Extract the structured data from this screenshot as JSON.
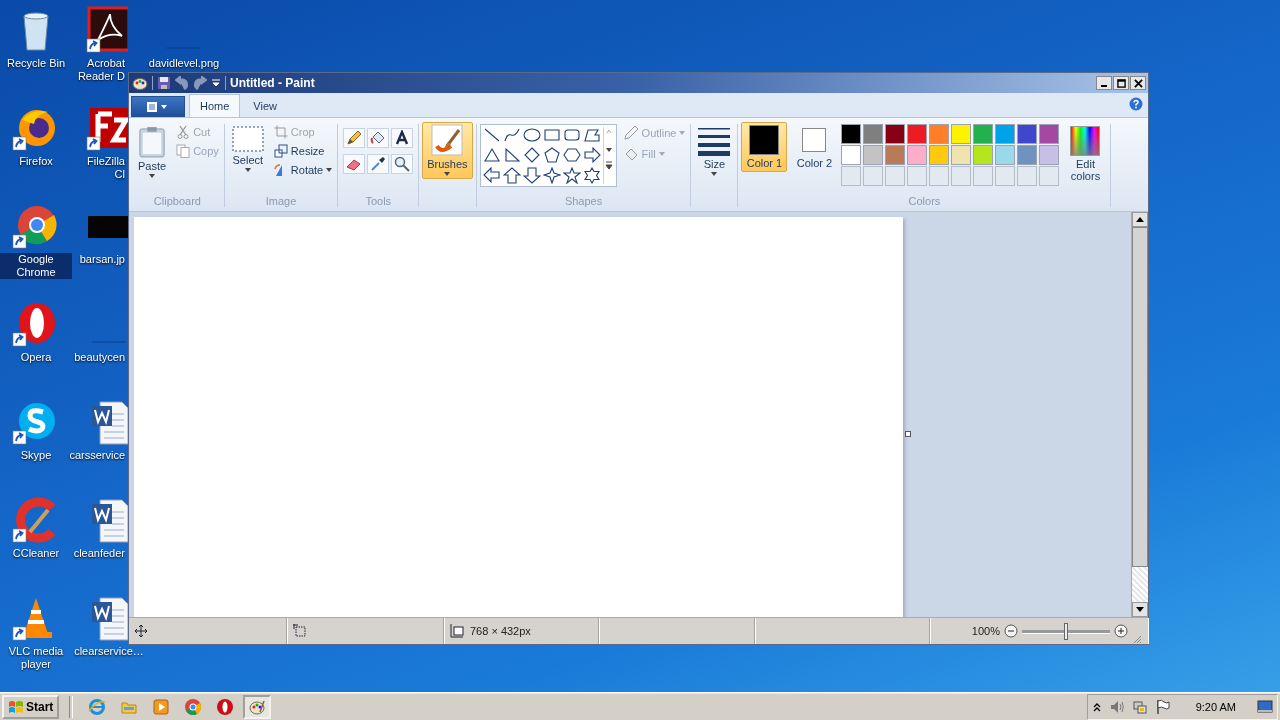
{
  "desktop_icons": [
    {
      "label": "Recycle Bin",
      "kind": "recycle",
      "selected": false
    },
    {
      "label": "Firefox",
      "kind": "firefox",
      "selected": false
    },
    {
      "label": "Google Chrome",
      "kind": "chrome",
      "selected": true
    },
    {
      "label": "Opera",
      "kind": "opera",
      "selected": false
    },
    {
      "label": "Skype",
      "kind": "skype",
      "selected": false
    },
    {
      "label": "CCleaner",
      "kind": "ccleaner",
      "selected": false
    },
    {
      "label": "VLC media player",
      "kind": "vlc",
      "selected": false
    },
    {
      "label": "Acrobat Reader D",
      "kind": "acrobat",
      "selected": false
    },
    {
      "label": "FileZilla Cl",
      "kind": "filezilla",
      "selected": false
    },
    {
      "label": "barsan.jp",
      "kind": "dark-image",
      "selected": false
    },
    {
      "label": "beautycen",
      "kind": "blank-image",
      "selected": false
    },
    {
      "label": "carsservice",
      "kind": "word",
      "selected": false
    },
    {
      "label": "cleanfeder",
      "kind": "word",
      "selected": false
    },
    {
      "label": "clearservice…",
      "kind": "word",
      "selected": false
    },
    {
      "label": "davidlevel.png",
      "kind": "blank-image",
      "selected": false
    }
  ],
  "window": {
    "title": "Untitled - Paint"
  },
  "tabs": [
    {
      "label": "Home",
      "selected": true
    },
    {
      "label": "View",
      "selected": false
    }
  ],
  "clipboard": {
    "paste": "Paste",
    "cut": {
      "label": "Cut",
      "disabled": true
    },
    "copy": {
      "label": "Copy",
      "disabled": true
    },
    "group": "Clipboard"
  },
  "image": {
    "select": "Select",
    "crop": {
      "label": "Crop",
      "disabled": true
    },
    "resize": {
      "label": "Resize",
      "disabled": false
    },
    "rotate": {
      "label": "Rotate",
      "disabled": false
    },
    "group": "Image"
  },
  "tools": {
    "items": [
      {
        "kind": "pencil",
        "selected": false
      },
      {
        "kind": "fill",
        "selected": false
      },
      {
        "kind": "text",
        "selected": false
      },
      {
        "kind": "eraser",
        "selected": false
      },
      {
        "kind": "picker",
        "selected": false
      },
      {
        "kind": "magnifier",
        "selected": false
      }
    ],
    "group": "Tools"
  },
  "brushes": {
    "label": "Brushes",
    "selected": true
  },
  "shapes": {
    "items": [
      {
        "kind": "line"
      },
      {
        "kind": "curve"
      },
      {
        "kind": "oval"
      },
      {
        "kind": "rectangle"
      },
      {
        "kind": "rounded"
      },
      {
        "kind": "polygon"
      },
      {
        "kind": "triangle"
      },
      {
        "kind": "right-triangle"
      },
      {
        "kind": "diamond"
      },
      {
        "kind": "pentagon"
      },
      {
        "kind": "hexagon"
      },
      {
        "kind": "right-arrow"
      },
      {
        "kind": "left-arrow"
      },
      {
        "kind": "up-arrow"
      },
      {
        "kind": "down-arrow"
      },
      {
        "kind": "star4"
      },
      {
        "kind": "star5"
      },
      {
        "kind": "star6"
      }
    ],
    "outline": {
      "label": "Outline",
      "disabled": true
    },
    "fill": {
      "label": "Fill",
      "disabled": true
    },
    "group": "Shapes"
  },
  "size": {
    "label": "Size"
  },
  "colors": {
    "color1": {
      "label": "Color 1",
      "color": "#000000",
      "selected": true
    },
    "color2": {
      "label": "Color 2",
      "color": "#ffffff",
      "selected": false
    },
    "palette": [
      {
        "color": "#000000"
      },
      {
        "color": "#7f7f7f"
      },
      {
        "color": "#880015"
      },
      {
        "color": "#ed1c24"
      },
      {
        "color": "#ff7f27"
      },
      {
        "color": "#fff200"
      },
      {
        "color": "#22b14c"
      },
      {
        "color": "#00a2e8"
      },
      {
        "color": "#3f48cc"
      },
      {
        "color": "#a349a4"
      },
      {
        "color": "#ffffff"
      },
      {
        "color": "#c3c3c3"
      },
      {
        "color": "#b97a57"
      },
      {
        "color": "#ffaec9"
      },
      {
        "color": "#ffc90e"
      },
      {
        "color": "#efe4b0"
      },
      {
        "color": "#b5e61d"
      },
      {
        "color": "#99d9ea"
      },
      {
        "color": "#7092be"
      },
      {
        "color": "#c8bfe7"
      }
    ],
    "edit": "Edit colors",
    "group": "Colors"
  },
  "status_bar": {
    "dimensions": "768 × 432px",
    "zoom": "100%",
    "zoom_slider": {
      "level": 0.5
    }
  },
  "taskbar": {
    "start": "Start",
    "items": [
      {
        "kind": "ie",
        "selected": false
      },
      {
        "kind": "explorer",
        "selected": false
      },
      {
        "kind": "media",
        "selected": false
      },
      {
        "kind": "chrome",
        "selected": false
      },
      {
        "kind": "opera",
        "selected": false
      },
      {
        "kind": "paint",
        "selected": true
      }
    ],
    "clock": "9:20 AM"
  }
}
